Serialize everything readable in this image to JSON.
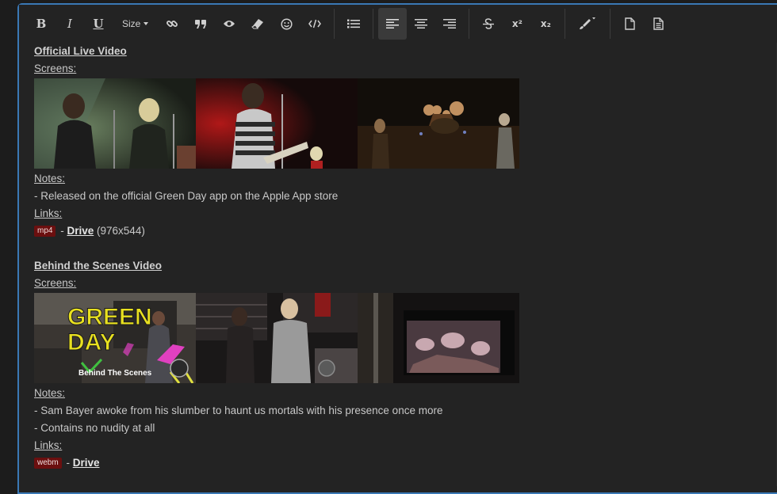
{
  "toolbar": {
    "bold": "B",
    "italic": "I",
    "underline": "U",
    "size_label": "Size",
    "icons": [
      "link-icon",
      "quote-icon",
      "spoiler-eye-icon",
      "eraser-icon",
      "smiley-icon",
      "code-icon",
      "list-icon",
      "align-left-icon",
      "align-center-icon",
      "align-right-icon",
      "strikethrough-icon",
      "superscript-icon",
      "subscript-icon",
      "brush-icon",
      "blank-page-icon",
      "page-text-icon"
    ],
    "superscript": "x²",
    "subscript": "x₂"
  },
  "sections": [
    {
      "title": "Official Live Video",
      "screens_label": "Screens:",
      "notes_label": "Notes:",
      "notes": [
        "- Released on the official Green Day app on the Apple App store"
      ],
      "links_label": "Links:",
      "link": {
        "badge": "mp4",
        "separator": "-",
        "text": "Drive",
        "extra": "(976x544)"
      }
    },
    {
      "title": "Behind the Scenes Video",
      "screens_label": "Screens:",
      "overlay_title": "GREEN DAY",
      "overlay_sub": "Behind The Scenes",
      "notes_label": "Notes:",
      "notes": [
        "- Sam Bayer awoke from his slumber to haunt us mortals with his presence once more",
        "- Contains no nudity at all"
      ],
      "links_label": "Links:",
      "link": {
        "badge": "webm",
        "separator": "-",
        "text": "Drive"
      }
    }
  ],
  "colors": {
    "accent": "#3a78b5",
    "badge": "#6b0f0f",
    "background": "#232323"
  }
}
